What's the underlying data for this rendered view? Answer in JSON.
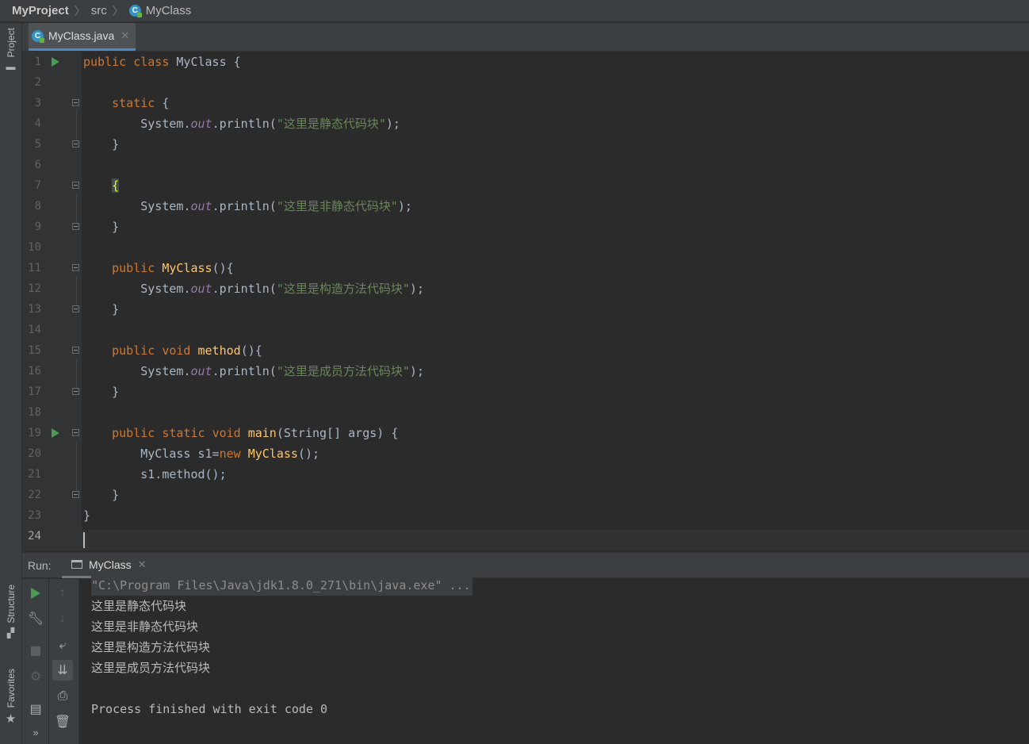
{
  "breadcrumb": {
    "project": "MyProject",
    "folder": "src",
    "file": "MyClass"
  },
  "left_strip": {
    "project": "Project",
    "structure": "Structure",
    "favorites": "Favorites",
    "more": "»"
  },
  "editor": {
    "active_tab": "MyClass.java",
    "line_numbers": [
      "1",
      "2",
      "3",
      "4",
      "5",
      "6",
      "7",
      "8",
      "9",
      "10",
      "11",
      "12",
      "13",
      "14",
      "15",
      "16",
      "17",
      "18",
      "19",
      "20",
      "21",
      "22",
      "23",
      "24"
    ],
    "current_line": "24",
    "run_gutter_lines": [
      "1",
      "19"
    ],
    "code_lines": [
      "public class MyClass {",
      "",
      "    static {",
      "        System.out.println(\"这里是静态代码块\");",
      "    }",
      "",
      "    {",
      "        System.out.println(\"这里是非静态代码块\");",
      "    }",
      "",
      "    public MyClass(){",
      "        System.out.println(\"这里是构造方法代码块\");",
      "    }",
      "",
      "    public void method(){",
      "        System.out.println(\"这里是成员方法代码块\");",
      "    }",
      "",
      "    public static void main(String[] args) {",
      "        MyClass s1=new MyClass();",
      "        s1.method();",
      "    }",
      "}",
      ""
    ]
  },
  "run_panel": {
    "label": "Run:",
    "tab": "MyClass",
    "console_lines": [
      "\"C:\\Program Files\\Java\\jdk1.8.0_271\\bin\\java.exe\" ...",
      "这里是静态代码块",
      "这里是非静态代码块",
      "这里是构造方法代码块",
      "这里是成员方法代码块",
      "",
      "Process finished with exit code 0"
    ]
  },
  "colors": {
    "keyword": "#cc7832",
    "string": "#6a8759",
    "method_decl": "#ffc66d",
    "static_field": "#9876aa",
    "default_text": "#a9b7c6",
    "background": "#2b2b2b",
    "panel": "#3c3f41",
    "accent": "#4a88c7"
  }
}
